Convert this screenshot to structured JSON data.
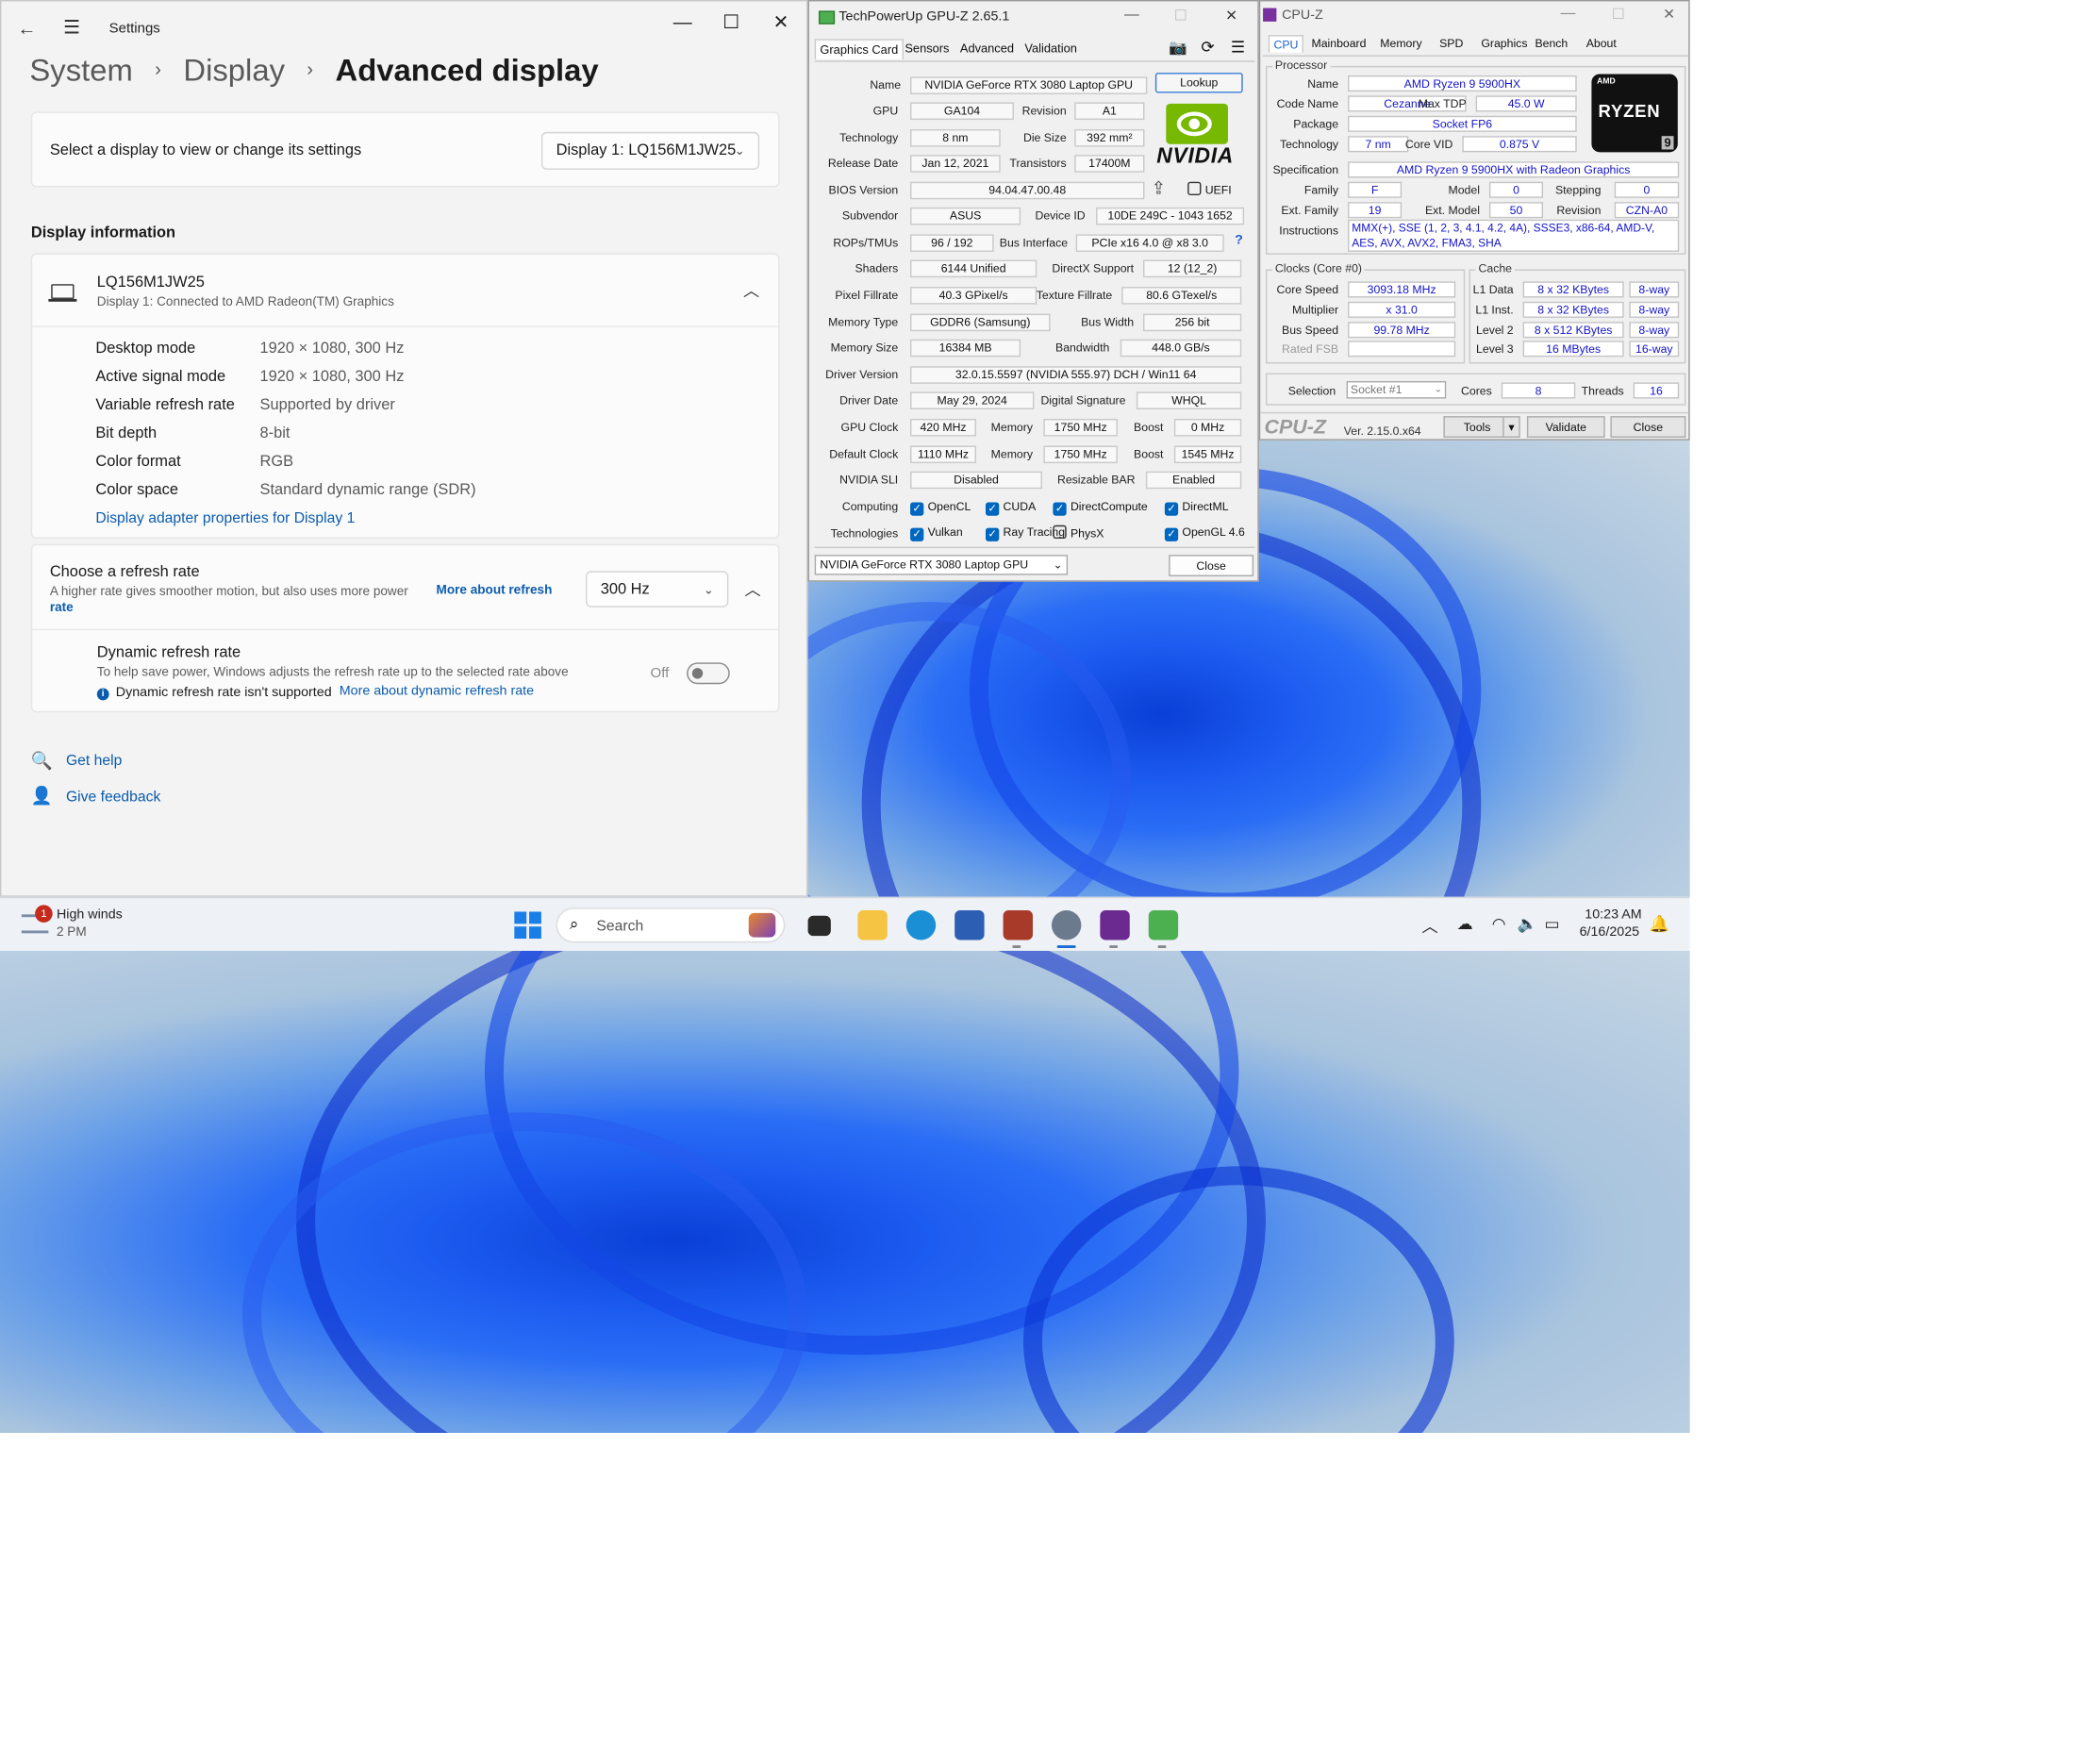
{
  "settings": {
    "app_title": "Settings",
    "breadcrumb": [
      "System",
      "Display",
      "Advanced display"
    ],
    "select_display_label": "Select a display to view or change its settings",
    "select_display_value": "Display 1: LQ156M1JW25",
    "display_info_heading": "Display information",
    "monitor_name": "LQ156M1JW25",
    "monitor_sub": "Display 1: Connected to AMD Radeon(TM) Graphics",
    "info": [
      {
        "k": "Desktop mode",
        "v": "1920 × 1080, 300 Hz"
      },
      {
        "k": "Active signal mode",
        "v": "1920 × 1080, 300 Hz"
      },
      {
        "k": "Variable refresh rate",
        "v": "Supported by driver"
      },
      {
        "k": "Bit depth",
        "v": "8-bit"
      },
      {
        "k": "Color format",
        "v": "RGB"
      },
      {
        "k": "Color space",
        "v": "Standard dynamic range (SDR)"
      }
    ],
    "adapter_link": "Display adapter properties for Display 1",
    "refresh_title": "Choose a refresh rate",
    "refresh_sub": "A higher rate gives smoother motion, but also uses more power",
    "refresh_link_1": "More about refresh",
    "refresh_link_2": "rate",
    "refresh_value": "300 Hz",
    "dynamic_title": "Dynamic refresh rate",
    "dynamic_sub": "To help save power, Windows adjusts the refresh rate up to the selected rate above",
    "dynamic_state": "Off",
    "dynamic_warn": "Dynamic refresh rate isn't supported",
    "dynamic_link": "More about dynamic refresh rate",
    "get_help": "Get help",
    "give_feedback": "Give feedback"
  },
  "gpuz": {
    "title": "TechPowerUp GPU-Z 2.65.1",
    "tabs": [
      "Graphics Card",
      "Sensors",
      "Advanced",
      "Validation"
    ],
    "lookup": "Lookup",
    "rows": {
      "name_k": "Name",
      "name_v": "NVIDIA GeForce RTX 3080 Laptop GPU",
      "gpu_k": "GPU",
      "gpu_v": "GA104",
      "rev_k": "Revision",
      "rev_v": "A1",
      "tech_k": "Technology",
      "tech_v": "8 nm",
      "die_k": "Die Size",
      "die_v": "392 mm²",
      "rel_k": "Release Date",
      "rel_v": "Jan 12, 2021",
      "trans_k": "Transistors",
      "trans_v": "17400M",
      "bios_k": "BIOS Version",
      "bios_v": "94.04.47.00.48",
      "uefi": "UEFI",
      "subv_k": "Subvendor",
      "subv_v": "ASUS",
      "devid_k": "Device ID",
      "devid_v": "10DE 249C - 1043 1652",
      "rops_k": "ROPs/TMUs",
      "rops_v": "96 / 192",
      "bus_k": "Bus Interface",
      "bus_v": "PCIe x16 4.0 @ x8 3.0",
      "bus_q": "?",
      "shaders_k": "Shaders",
      "shaders_v": "6144 Unified",
      "dx_k": "DirectX Support",
      "dx_v": "12 (12_2)",
      "pix_k": "Pixel Fillrate",
      "pix_v": "40.3 GPixel/s",
      "tex_k": "Texture Fillrate",
      "tex_v": "80.6 GTexel/s",
      "memt_k": "Memory Type",
      "memt_v": "GDDR6 (Samsung)",
      "bw_k": "Bus Width",
      "bw_v": "256 bit",
      "mems_k": "Memory Size",
      "mems_v": "16384 MB",
      "band_k": "Bandwidth",
      "band_v": "448.0 GB/s",
      "drv_k": "Driver Version",
      "drv_v": "32.0.15.5597 (NVIDIA 555.97) DCH / Win11 64",
      "drvd_k": "Driver Date",
      "drvd_v": "May 29, 2024",
      "sig_k": "Digital Signature",
      "sig_v": "WHQL",
      "gclk_k": "GPU Clock",
      "gclk_v": "420 MHz",
      "mem1_k": "Memory",
      "mem1_v": "1750 MHz",
      "boost1_k": "Boost",
      "boost1_v": "0 MHz",
      "dclk_k": "Default Clock",
      "dclk_v": "1110 MHz",
      "mem2_k": "Memory",
      "mem2_v": "1750 MHz",
      "boost2_k": "Boost",
      "boost2_v": "1545 MHz",
      "sli_k": "NVIDIA SLI",
      "sli_v": "Disabled",
      "rbar_k": "Resizable BAR",
      "rbar_v": "Enabled",
      "comp_k": "Computing",
      "tech2_k": "Technologies"
    },
    "computing": [
      {
        "n": "OpenCL",
        "on": true
      },
      {
        "n": "CUDA",
        "on": true
      },
      {
        "n": "DirectCompute",
        "on": true
      },
      {
        "n": "DirectML",
        "on": true
      }
    ],
    "technologies": [
      {
        "n": "Vulkan",
        "on": true
      },
      {
        "n": "Ray Tracing",
        "on": true
      },
      {
        "n": "PhysX",
        "on": false
      },
      {
        "n": "OpenGL 4.6",
        "on": true
      }
    ],
    "select_gpu": "NVIDIA GeForce RTX 3080 Laptop GPU",
    "close": "Close",
    "nvidia_logo": "NVIDIA"
  },
  "cpuz": {
    "title": "CPU-Z",
    "tabs": [
      "CPU",
      "Mainboard",
      "Memory",
      "SPD",
      "Graphics",
      "Bench",
      "About"
    ],
    "processor": "Processor",
    "name_k": "Name",
    "name_v": "AMD Ryzen 9 5900HX",
    "code_k": "Code Name",
    "code_v": "Cezanne",
    "tdp_k": "Max TDP",
    "tdp_v": "45.0 W",
    "pkg_k": "Package",
    "pkg_v": "Socket FP6",
    "tech_k": "Technology",
    "tech_v": "7 nm",
    "vid_k": "Core VID",
    "vid_v": "0.875 V",
    "spec_k": "Specification",
    "spec_v": "AMD Ryzen 9 5900HX with Radeon Graphics",
    "fam_k": "Family",
    "fam_v": "F",
    "model_k": "Model",
    "model_v": "0",
    "step_k": "Stepping",
    "step_v": "0",
    "efam_k": "Ext. Family",
    "efam_v": "19",
    "emod_k": "Ext. Model",
    "emod_v": "50",
    "rev_k": "Revision",
    "rev_v": "CZN-A0",
    "inst_k": "Instructions",
    "inst_v1": "MMX(+), SSE (1, 2, 3, 4.1, 4.2, 4A), SSSE3, x86-64, AMD-V,",
    "inst_v2": "AES, AVX, AVX2, FMA3, SHA",
    "clocks": "Clocks (Core #0)",
    "cache": "Cache",
    "cs_k": "Core Speed",
    "cs_v": "3093.18 MHz",
    "mul_k": "Multiplier",
    "mul_v": "x 31.0",
    "bs_k": "Bus Speed",
    "bs_v": "99.78 MHz",
    "fsb_k": "Rated FSB",
    "l1d_k": "L1 Data",
    "l1d_v": "8 x 32 KBytes",
    "l1d_w": "8-way",
    "l1i_k": "L1 Inst.",
    "l1i_v": "8 x 32 KBytes",
    "l1i_w": "8-way",
    "l2_k": "Level 2",
    "l2_v": "8 x 512 KBytes",
    "l2_w": "8-way",
    "l3_k": "Level 3",
    "l3_v": "16 MBytes",
    "l3_w": "16-way",
    "sel_k": "Selection",
    "sel_v": "Socket #1",
    "cores_k": "Cores",
    "cores_v": "8",
    "thr_k": "Threads",
    "thr_v": "16",
    "brand": "CPU-Z",
    "ver": "Ver. 2.15.0.x64",
    "tools": "Tools",
    "validate": "Validate",
    "close": "Close",
    "logo_top": "AMD",
    "logo_main": "RYZEN",
    "logo_num": "9"
  },
  "taskbar": {
    "weather_title": "High winds",
    "weather_sub": "2 PM",
    "weather_badge": "1",
    "search": "Search",
    "time": "10:23 AM",
    "date": "6/16/2025"
  }
}
